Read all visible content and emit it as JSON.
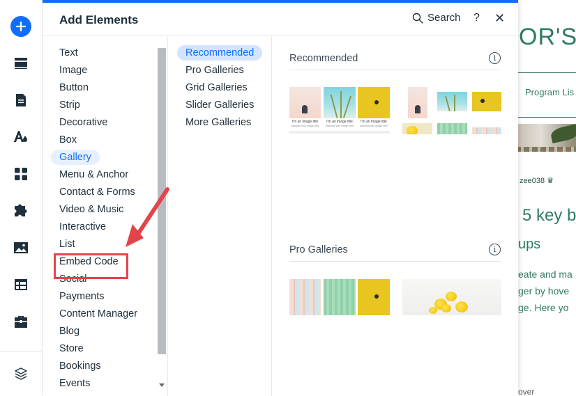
{
  "toolbar": {
    "items": [
      {
        "name": "add-elements",
        "icon": "plus-icon"
      },
      {
        "name": "sections",
        "icon": "sections-icon"
      },
      {
        "name": "pages",
        "icon": "page-icon"
      },
      {
        "name": "design",
        "icon": "theme-icon"
      },
      {
        "name": "apps",
        "icon": "apps-grid-icon"
      },
      {
        "name": "business-apps",
        "icon": "puzzle-icon"
      },
      {
        "name": "media",
        "icon": "image-icon"
      },
      {
        "name": "cms",
        "icon": "table-icon"
      },
      {
        "name": "business",
        "icon": "briefcase-icon"
      },
      {
        "name": "layers",
        "icon": "layers-icon"
      }
    ],
    "accent": "#116dff"
  },
  "panel": {
    "title": "Add Elements",
    "search_label": "Search",
    "help_label": "?",
    "close_label": "✕",
    "categories": [
      {
        "label": "Text",
        "active": false
      },
      {
        "label": "Image",
        "active": false
      },
      {
        "label": "Button",
        "active": false
      },
      {
        "label": "Strip",
        "active": false
      },
      {
        "label": "Decorative",
        "active": false
      },
      {
        "label": "Box",
        "active": false
      },
      {
        "label": "Gallery",
        "active": true
      },
      {
        "label": "Menu & Anchor",
        "active": false
      },
      {
        "label": "Contact & Forms",
        "active": false
      },
      {
        "label": "Video & Music",
        "active": false
      },
      {
        "label": "Interactive",
        "active": false
      },
      {
        "label": "List",
        "active": false
      },
      {
        "label": "Embed Code",
        "active": false
      },
      {
        "label": "Social",
        "active": false
      },
      {
        "label": "Payments",
        "active": false
      },
      {
        "label": "Content Manager",
        "active": false
      },
      {
        "label": "Blog",
        "active": false
      },
      {
        "label": "Store",
        "active": false
      },
      {
        "label": "Bookings",
        "active": false
      },
      {
        "label": "Events",
        "active": false
      }
    ],
    "subcategories": [
      {
        "label": "Recommended",
        "active": true
      },
      {
        "label": "Pro Galleries",
        "active": false
      },
      {
        "label": "Grid Galleries",
        "active": false
      },
      {
        "label": "Slider Galleries",
        "active": false
      },
      {
        "label": "More Galleries",
        "active": false
      }
    ],
    "sections": [
      {
        "title": "Recommended",
        "info": "i"
      },
      {
        "title": "Pro Galleries",
        "info": "i"
      }
    ],
    "thumb_caption": "I'm an image title",
    "thumb_subcaption": "Describe your image here"
  },
  "site_preview": {
    "title": "OR'S",
    "nav_item": "Program Lis",
    "author": "zee038",
    "heading": "5 key b",
    "subheading": "ups",
    "para_1": "eate and ma",
    "para_2": "ger by hove",
    "para_3": "ge. Here yo",
    "bottom_text": "over"
  },
  "annotation": {
    "highlight_target": "Embed Code",
    "color": "#e4434a"
  }
}
